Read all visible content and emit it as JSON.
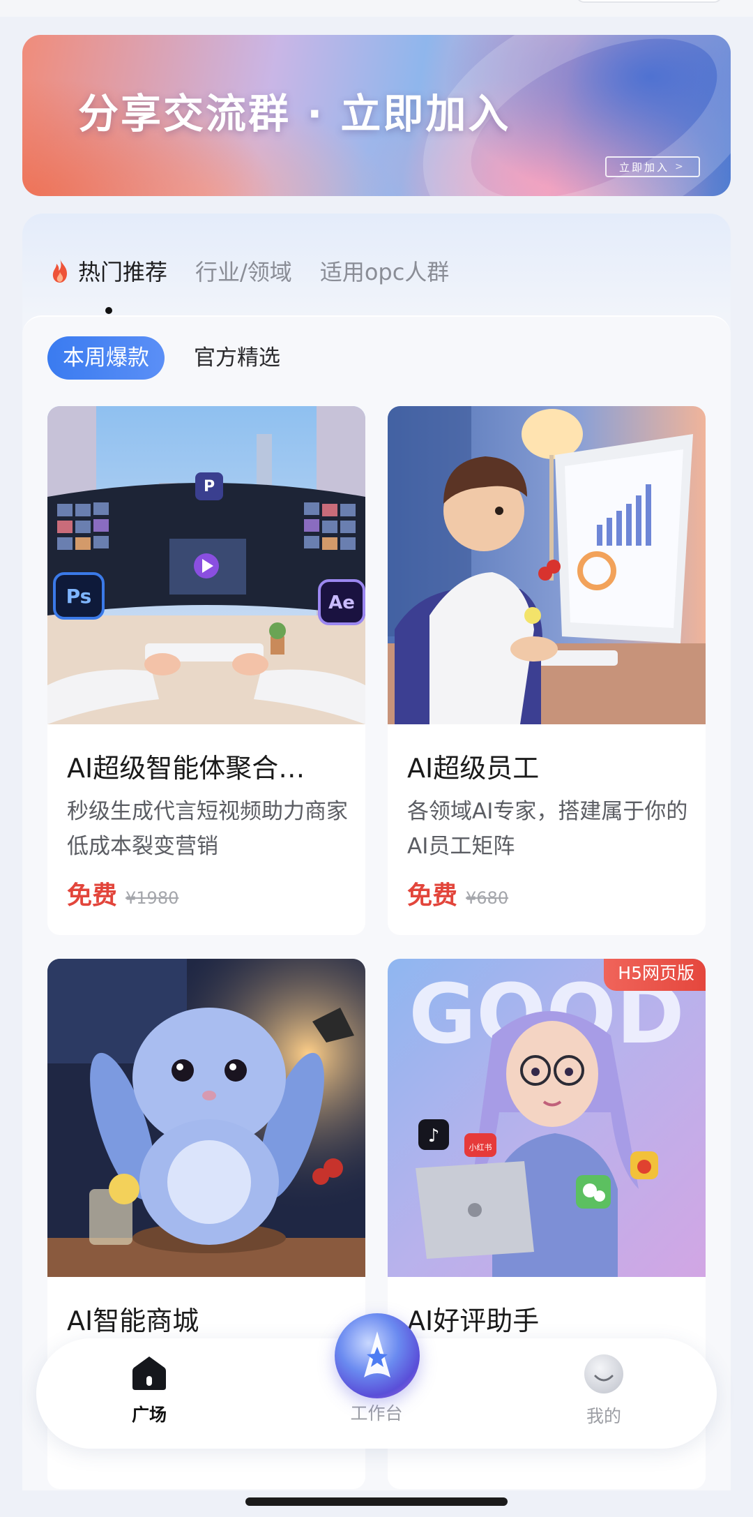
{
  "banner": {
    "title": "分享交流群 · 立即加入",
    "button_label": "立即加入"
  },
  "category_tabs": [
    {
      "label": "热门推荐",
      "active": true
    },
    {
      "label": "行业/领域",
      "active": false
    },
    {
      "label": "适用opc人群",
      "active": false
    }
  ],
  "sub_tabs": [
    {
      "label": "本周爆款",
      "active": true
    },
    {
      "label": "官方精选",
      "active": false
    }
  ],
  "cards": [
    {
      "title": "AI超级智能体聚合…",
      "desc": "秒级生成代言短视频助力商家低成本裂变营销",
      "price": "免费",
      "original_price": "¥1980"
    },
    {
      "title": "AI超级员工",
      "desc": "各领域AI专家，搭建属于你的AI员工矩阵",
      "price": "免费",
      "original_price": "¥680"
    },
    {
      "title": "AI智能商城",
      "desc": "",
      "price": "",
      "original_price": ""
    },
    {
      "title": "AI好评助手",
      "desc": "",
      "price": "",
      "original_price": "",
      "badge": "H5网页版"
    }
  ],
  "image_text": {
    "ps_icon": "Ps",
    "ae_icon": "Ae",
    "p_icon": "P",
    "good": "GOOD",
    "xhs_icon": "小红书"
  },
  "bottom_nav": [
    {
      "label": "广场",
      "icon": "home-icon",
      "active": true
    },
    {
      "label": "工作台",
      "icon": "ai-star-icon",
      "active": false
    },
    {
      "label": "我的",
      "icon": "profile-icon",
      "active": false
    }
  ],
  "colors": {
    "accent_blue": "#3a7bf0",
    "price_red": "#e2453b",
    "badge_red": "#e4463c"
  }
}
